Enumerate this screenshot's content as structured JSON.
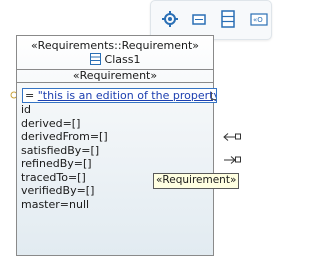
{
  "toolbar": {
    "icons": [
      "palette-icon",
      "rectangle-icon",
      "compartment-icon",
      "stereotype-icon"
    ],
    "partial_label": "«O"
  },
  "node": {
    "stereotype": "«Requirements::Requirement»",
    "name": "Class1",
    "compartment_title": "«Requirement»",
    "edit_prefix": "=",
    "edit_value": "\"this is an edition of the property\"",
    "attributes": [
      "id",
      "derived=[]",
      "derivedFrom=[]",
      "satisfiedBy=[]",
      "refinedBy=[]",
      "tracedTo=[]",
      "verifiedBy=[]",
      "master=null"
    ]
  },
  "tooltip": {
    "text": "«Requirement»"
  },
  "colors": {
    "border": "#8a8a8a",
    "edit_border": "#3574c4",
    "tooltip_bg": "#ffffe1",
    "accent_blue": "#1d3fb0"
  }
}
